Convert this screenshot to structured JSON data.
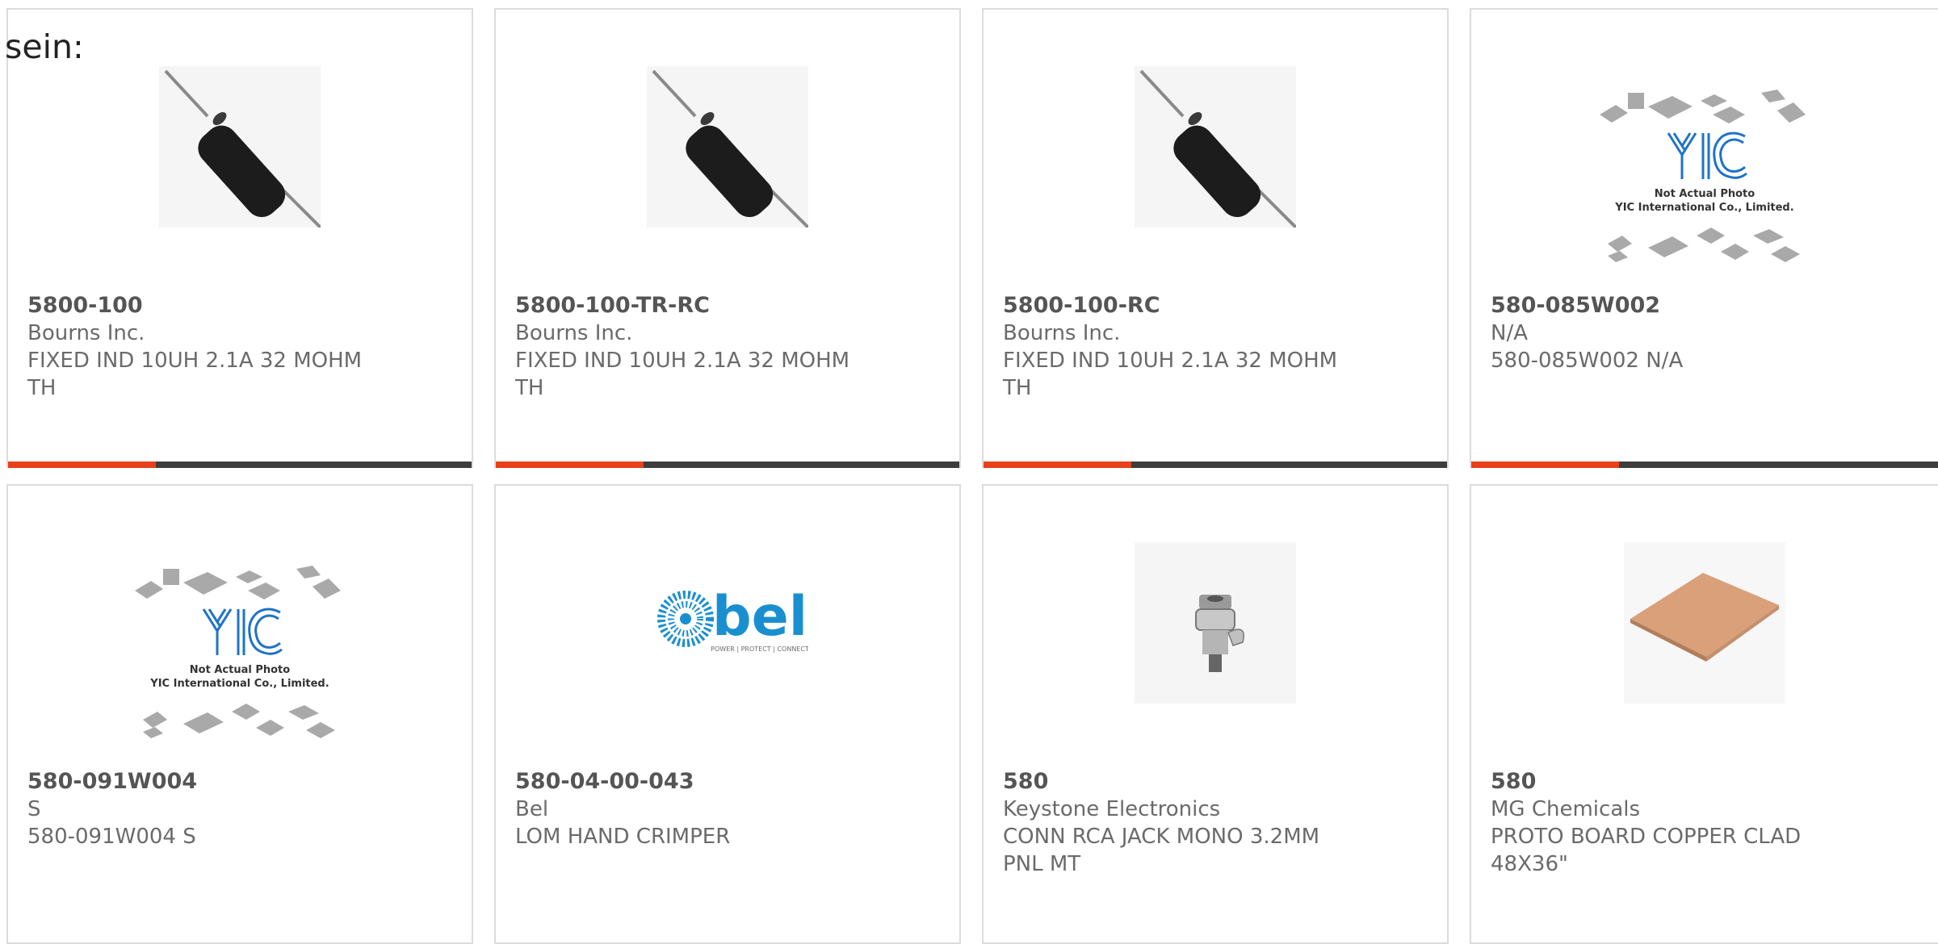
{
  "intro": "sein:",
  "products": [
    {
      "part": "5800-100",
      "mfr": "Bourns Inc.",
      "desc": "FIXED IND 10UH 2.1A 32 MOHM TH",
      "image": "inductor-image"
    },
    {
      "part": "5800-100-TR-RC",
      "mfr": "Bourns Inc.",
      "desc": "FIXED IND 10UH 2.1A 32 MOHM TH",
      "image": "inductor-image"
    },
    {
      "part": "5800-100-RC",
      "mfr": "Bourns Inc.",
      "desc": "FIXED IND 10UH 2.1A 32 MOHM TH",
      "image": "inductor-image"
    },
    {
      "part": "580-085W002",
      "mfr": "N/A",
      "desc": "580-085W002 N/A",
      "image": "yic-placeholder-image"
    },
    {
      "part": "580-091W004",
      "mfr": "S",
      "desc": "580-091W004 S",
      "image": "yic-placeholder-image"
    },
    {
      "part": "580-04-00-043",
      "mfr": "Bel",
      "desc": "LOM HAND CRIMPER",
      "image": "bel-logo-image"
    },
    {
      "part": "580",
      "mfr": "Keystone Electronics",
      "desc": "CONN RCA JACK MONO 3.2MM PNL MT",
      "image": "rca-jack-image"
    },
    {
      "part": "580",
      "mfr": "MG Chemicals",
      "desc": "PROTO BOARD COPPER CLAD 48X36\"",
      "image": "copper-board-image"
    }
  ],
  "placeholder": {
    "brand": "YIC",
    "line1": "Not Actual Photo",
    "line2": "YIC International Co., Limited."
  },
  "bel_logo": {
    "name": "bel",
    "tagline": "POWER | PROTECT | CONNECT"
  },
  "colors": {
    "accent": "#e8401c",
    "bar": "#3d3d3d",
    "card_border": "#dcdcdc",
    "bel_blue": "#1a8fd0",
    "yic_blue": "#1e73c8",
    "copper": "#d9a07a"
  }
}
